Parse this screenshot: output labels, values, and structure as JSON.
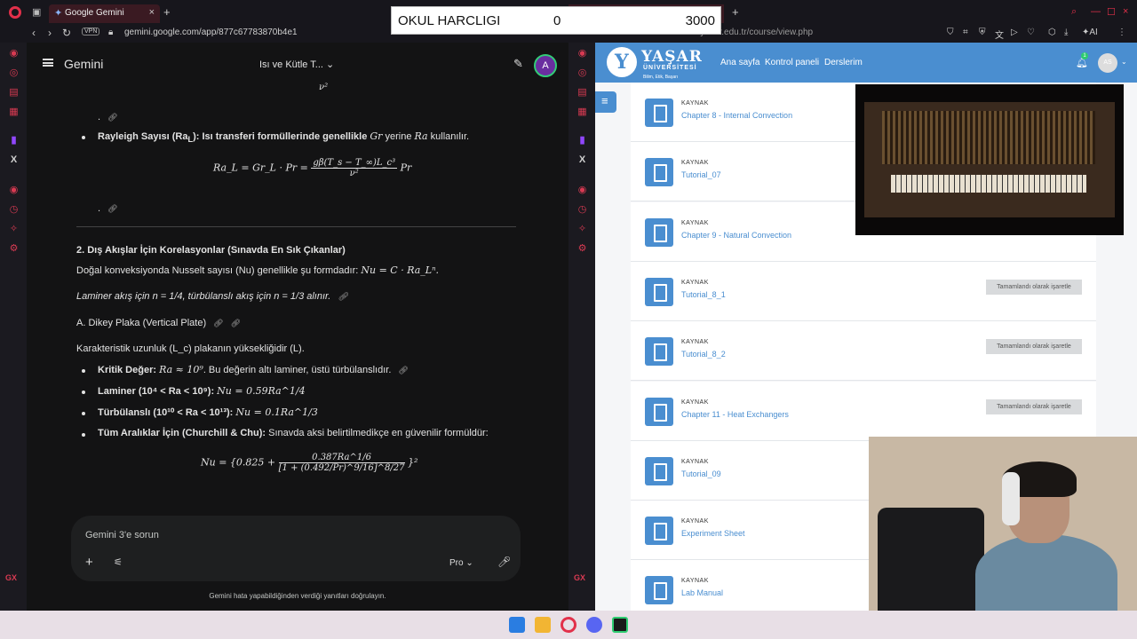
{
  "left_browser": {
    "tab_title": "Google Gemini",
    "url": "gemini.google.com/app/877c67783870b4e1",
    "vpn": "VPN"
  },
  "gemini": {
    "app_title": "Gemini",
    "conversation_title": "Isı ve Kütle T...",
    "avatar_letter": "A",
    "lines": {
      "frag": "ν²",
      "rayleigh_label": "Rayleigh Sayısı (Ra",
      "rayleigh_sub": "L",
      "rayleigh_tail": "): Isı transferi formüllerinde genellikle",
      "rayleigh_gr": "Gr",
      "rayleigh_yerine": "yerine",
      "rayleigh_ra": "Ra",
      "rayleigh_end": "kullanılır.",
      "ra_formula_left": "Ra_L = Gr_L · Pr =",
      "ra_formula_num": "gβ(T_s − T_∞)L_c³",
      "ra_formula_den": "ν²",
      "ra_formula_right": "Pr",
      "section_heading": "2. Dış Akışlar İçin Korelasyonlar (Sınavda En Sık Çıkanlar)",
      "nusselt_text": "Doğal konveksiyonda Nusselt sayısı (Nu) genellikle şu formdadır:",
      "nusselt_formula": "Nu = C · Ra_Lⁿ.",
      "laminar_text": "Laminer akış için n = 1/4, türbülanslı akış için n = 1/3 alınır.",
      "subsection": "A. Dikey Plaka (Vertical Plate)",
      "char_length": "Karakteristik uzunluk (L_c) plakanın yüksekliğidir (L).",
      "critical_label": "Kritik Değer:",
      "critical_formula": "Ra ≈ 10⁹",
      "critical_text": ". Bu değerin altı laminer, üstü türbülanslıdır.",
      "laminar_label": "Laminer (10⁴ < Ra < 10⁹):",
      "laminar_formula": "Nu = 0.59Ra^1/4",
      "turb_label": "Türbülanslı (10¹⁰ < Ra < 10¹³):",
      "turb_formula": "Nu = 0.1Ra^1/3",
      "all_label": "Tüm Aralıklar İçin (Churchill & Chu):",
      "all_text": "Sınavda aksi belirtilmedikçe en güvenilir formüldür:",
      "cc_left": "Nu = {0.825 +",
      "cc_num": "0.387Ra^1/6",
      "cc_den": "[1 + (0.492/Pr)^9/16]^8/27",
      "cc_right": "}²"
    },
    "input_placeholder": "Gemini 3'e sorun",
    "model_label": "Pro",
    "disclaimer": "Gemini hata yapabildiğinden verdiği yanıtları doğrulayın."
  },
  "counter": {
    "label": "OKUL HARCLIGI",
    "value_a": "0",
    "value_b": "3000"
  },
  "right_browser": {
    "url_prefix": "...",
    "url": "yasar.edu.tr/course/view.php",
    "ai_label": "AI"
  },
  "moodle": {
    "logo_text": "YAŞAR",
    "logo_sub": "ÜNİVERSİTESİ",
    "logo_motto": "Bilim, Etik, Başarı",
    "nav": [
      "Ana sayfa",
      "Kontrol paneli",
      "Derslerim"
    ],
    "notification_count": "1",
    "user_initials": "AS",
    "resource_type": "KAYNAK",
    "complete_button": "Tamamlandı olarak işaretle",
    "resources": [
      {
        "title": "Chapter 8 - Internal Convection",
        "button": false
      },
      {
        "title": "Tutorial_07",
        "button": false
      },
      {
        "title": "Chapter 9 - Natural Convection",
        "button": false
      },
      {
        "title": "Tutorial_8_1",
        "button": true
      },
      {
        "title": "Tutorial_8_2",
        "button": true
      },
      {
        "title": "Chapter 11 - Heat Exchangers",
        "button": true
      },
      {
        "title": "Tutorial_09",
        "button": false
      },
      {
        "title": "Experiment Sheet",
        "button": false
      },
      {
        "title": "Lab Manual",
        "button": false
      }
    ]
  }
}
